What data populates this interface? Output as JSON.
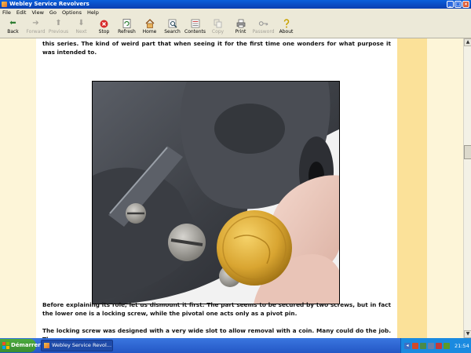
{
  "window": {
    "title": "Webley Service Revolvers"
  },
  "menu": [
    "File",
    "Edit",
    "View",
    "Go",
    "Options",
    "Help"
  ],
  "toolbar": [
    {
      "label": "Back",
      "icon": "back-arrow-icon",
      "disabled": false
    },
    {
      "label": "Forward",
      "icon": "forward-arrow-icon",
      "disabled": true
    },
    {
      "label": "Previous",
      "icon": "up-arrow-icon",
      "disabled": true
    },
    {
      "label": "Next",
      "icon": "down-arrow-icon",
      "disabled": true
    },
    {
      "label": "Stop",
      "icon": "stop-icon",
      "disabled": false
    },
    {
      "label": "Refresh",
      "icon": "refresh-icon",
      "disabled": false
    },
    {
      "label": "Home",
      "icon": "home-icon",
      "disabled": false
    },
    {
      "label": "Search",
      "icon": "search-icon",
      "disabled": false
    },
    {
      "label": "Contents",
      "icon": "contents-icon",
      "disabled": false
    },
    {
      "label": "Copy",
      "icon": "copy-icon",
      "disabled": true
    },
    {
      "label": "Print",
      "icon": "print-icon",
      "disabled": false
    },
    {
      "label": "Password",
      "icon": "key-icon",
      "disabled": true
    },
    {
      "label": "About",
      "icon": "about-icon",
      "disabled": false
    }
  ],
  "content": {
    "para1": "this series. The kind of weird part that when seeing it for the first time one wonders for what purpose it was intended to.",
    "para2": "Before explaining its role, let us dismount it first. The part seems to be secured by two screws, but in fact the lower one is a locking screw, while the pivotal one acts only as a pivot pin.",
    "para3": "The locking screw was designed with a very wide slot to allow removal with a coin. Many could do the job. The one"
  },
  "taskbar": {
    "start_label": "Démarrer",
    "task_label": "Webley Service Revol...",
    "clock": "21:54"
  },
  "colors": {
    "page_bg": "#ffffff",
    "margin_bg": "#fdf5d8",
    "band_bg": "#fbe199",
    "titlebar": "#0a5fdc",
    "taskbar": "#2457c5"
  }
}
